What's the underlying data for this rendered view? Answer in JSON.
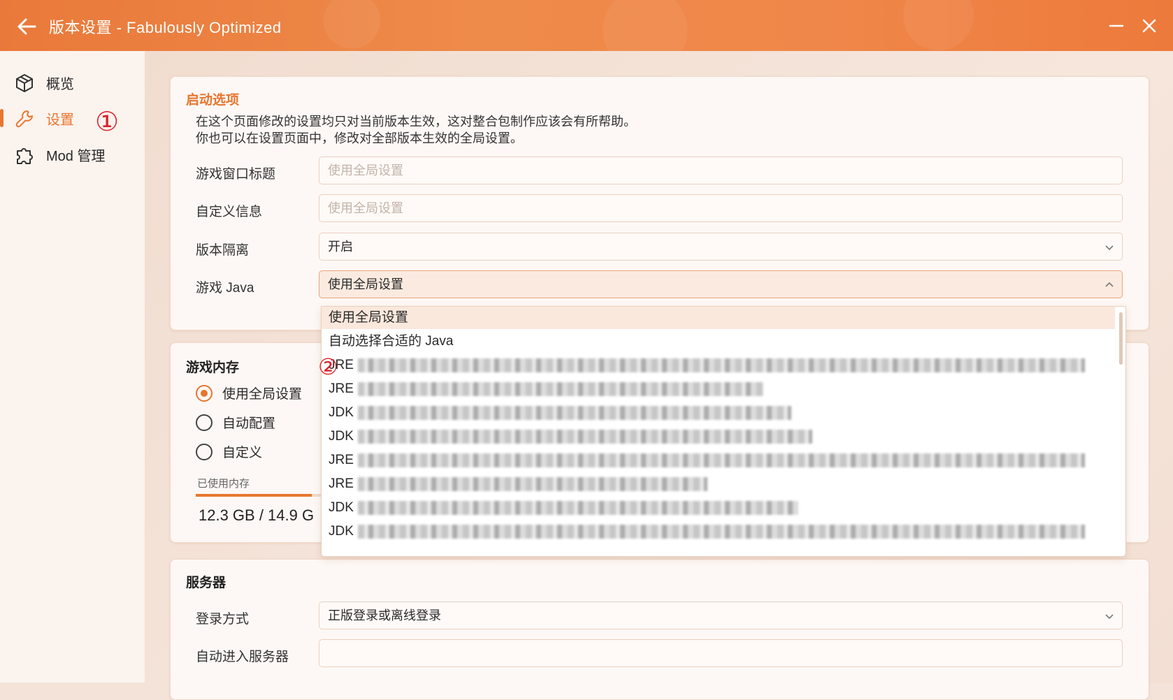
{
  "window": {
    "title": "版本设置 - Fabulously Optimized"
  },
  "sidebar": {
    "items": [
      {
        "label": "概览",
        "icon": "cube-icon"
      },
      {
        "label": "设置",
        "icon": "wrench-icon",
        "active": true
      },
      {
        "label": "Mod 管理",
        "icon": "puzzle-icon"
      }
    ]
  },
  "annotations": {
    "marker1": "①",
    "marker2": "②"
  },
  "launch_options": {
    "title": "启动选项",
    "description_line1": "在这个页面修改的设置均只对当前版本生效，这对整合包制作应该会有所帮助。",
    "description_line2": "你也可以在设置页面中，修改对全部版本生效的全局设置。",
    "window_title_label": "游戏窗口标题",
    "window_title_placeholder": "使用全局设置",
    "custom_info_label": "自定义信息",
    "custom_info_placeholder": "使用全局设置",
    "isolation_label": "版本隔离",
    "isolation_value": "开启",
    "java_label": "游戏 Java",
    "java_value": "使用全局设置"
  },
  "java_dropdown": {
    "options": [
      {
        "text": "使用全局设置",
        "selected": true
      },
      {
        "text": "自动选择合适的 Java"
      },
      {
        "text": "JRE",
        "redacted": true
      },
      {
        "text": "JRE",
        "redacted": true
      },
      {
        "text": "JDK",
        "redacted": true
      },
      {
        "text": "JDK",
        "redacted": true
      },
      {
        "text": "JRE",
        "redacted": true
      },
      {
        "text": "JRE",
        "redacted": true
      },
      {
        "text": "JDK",
        "redacted": true
      },
      {
        "text": "JDK",
        "redacted": true
      }
    ]
  },
  "memory": {
    "title": "游戏内存",
    "options": [
      "使用全局设置",
      "自动配置",
      "自定义"
    ],
    "selected_option": "使用全局设置",
    "used_label": "已使用内存",
    "usage_text": "12.3 GB / 14.9 G",
    "usage_fraction": 0.83
  },
  "server": {
    "title": "服务器",
    "login_label": "登录方式",
    "login_value": "正版登录或离线登录",
    "auto_join_label": "自动进入服务器",
    "auto_join_value": ""
  },
  "colors": {
    "accent": "#e8762f",
    "titlebar": "#ee8a4a",
    "marker": "#d9222a"
  }
}
